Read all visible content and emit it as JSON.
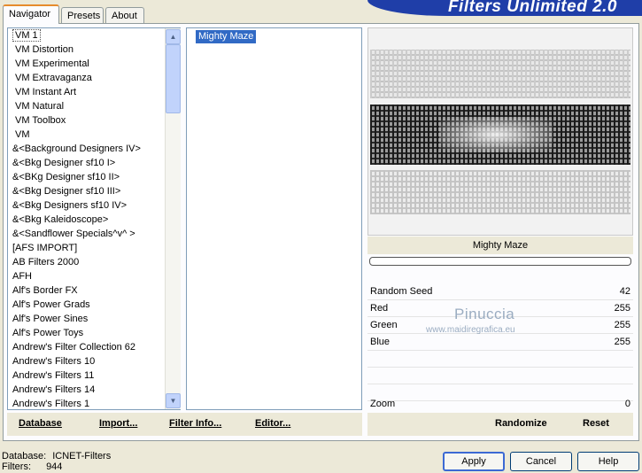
{
  "tabs": [
    {
      "label": "Navigator",
      "active": true
    },
    {
      "label": "Presets",
      "active": false
    },
    {
      "label": "About",
      "active": false
    }
  ],
  "app_title": "Filters Unlimited 2.0",
  "categories": [
    "VM 1",
    "VM Distortion",
    "VM Experimental",
    "VM Extravaganza",
    "VM Instant Art",
    "VM Natural",
    "VM Toolbox",
    "VM",
    "&<Background Designers IV>",
    "&<Bkg Designer sf10 I>",
    "&<BKg Designer sf10 II>",
    "&<Bkg Designer sf10 III>",
    "&<Bkg Designers sf10 IV>",
    "&<Bkg Kaleidoscope>",
    "&<Sandflower Specials^v^ >",
    "[AFS IMPORT]",
    "AB Filters 2000",
    "AFH",
    "Alf's Border FX",
    "Alf's Power Grads",
    "Alf's Power Sines",
    "Alf's Power Toys",
    "Andrew's Filter Collection 62",
    "Andrew's Filters 10",
    "Andrew's Filters 11",
    "Andrew's Filters 14",
    "Andrew's Filters 1"
  ],
  "selected_filter": "Mighty Maze",
  "preview_filter_name": "Mighty Maze",
  "params": [
    {
      "label": "Random Seed",
      "value": "42"
    },
    {
      "label": "Red",
      "value": "255"
    },
    {
      "label": "Green",
      "value": "255"
    },
    {
      "label": "Blue",
      "value": "255"
    },
    {
      "label": "",
      "value": ""
    },
    {
      "label": "",
      "value": ""
    },
    {
      "label": "",
      "value": ""
    }
  ],
  "zoom": {
    "label": "Zoom",
    "value": "0"
  },
  "watermark": {
    "line1": "Pinuccia",
    "line2": "www.maidiregrafica.eu"
  },
  "toolbar": {
    "database": "Database",
    "import": "Import...",
    "filter_info": "Filter Info...",
    "editor": "Editor...",
    "randomize": "Randomize",
    "reset": "Reset"
  },
  "status": {
    "database_label": "Database:",
    "database_value": "ICNET-Filters",
    "filters_label": "Filters:",
    "filters_value": "944"
  },
  "dialog": {
    "apply": "Apply",
    "cancel": "Cancel",
    "help": "Help"
  }
}
